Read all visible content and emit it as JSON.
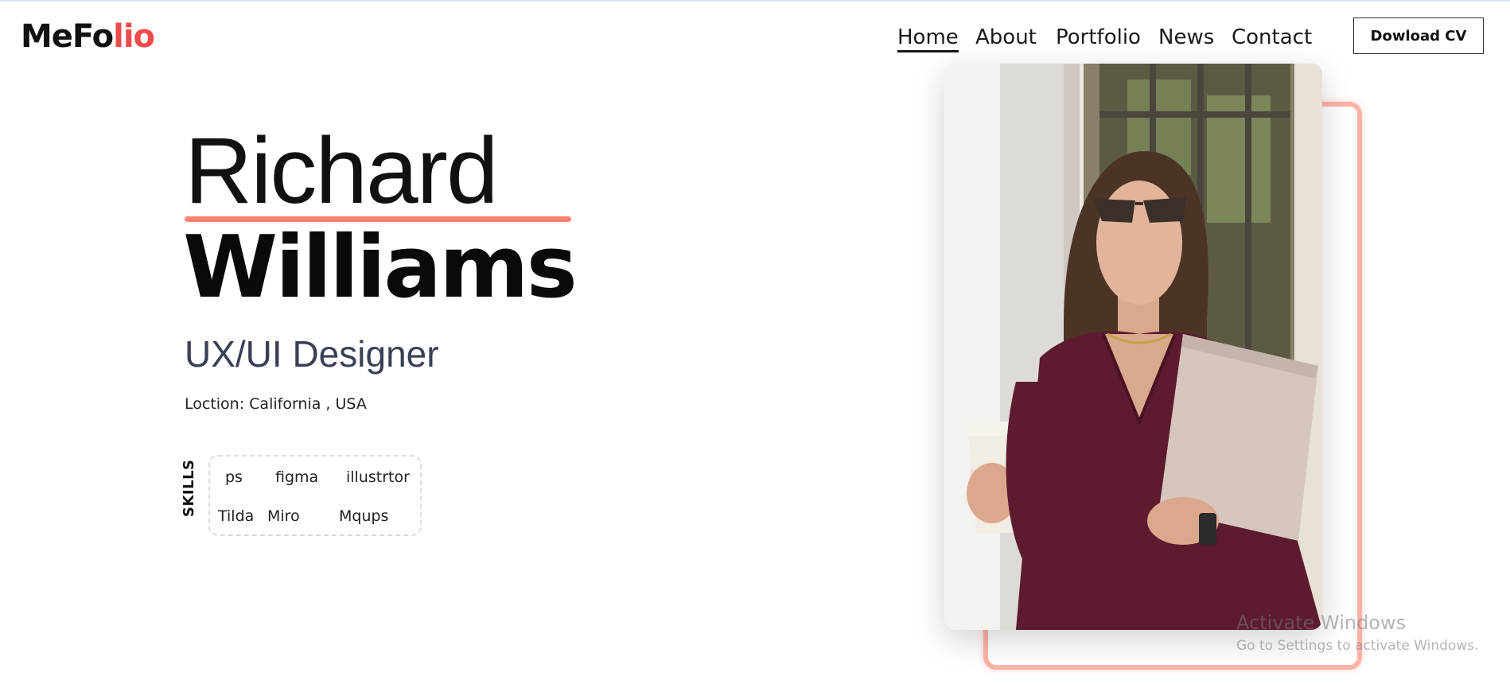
{
  "brand": {
    "logo_part1": "MeFo",
    "logo_part2": "lio"
  },
  "nav": [
    {
      "label": "Home",
      "active": true
    },
    {
      "label": "About"
    },
    {
      "label": "Portfolio"
    },
    {
      "label": "News"
    },
    {
      "label": "Contact"
    }
  ],
  "cta": {
    "label": "Dowload CV"
  },
  "hero": {
    "first_name": "Richard",
    "last_name": "Williams",
    "role": "UX/UI Designer",
    "location": "Loction: California , USA"
  },
  "skills": {
    "title": "SKILLS",
    "items": [
      "ps",
      "figma",
      "illustrtor",
      "Tilda",
      "Miro",
      "Mqups"
    ]
  },
  "photo": {
    "icon": "portrait-photo"
  },
  "watermark": {
    "title": "Activate Windows",
    "subtitle": "Go to Settings to activate Windows."
  },
  "colors": {
    "accent": "#f04a4a",
    "underline": "#ff8370",
    "frame": "#ff9a8a",
    "role_text": "#3b3f55"
  }
}
